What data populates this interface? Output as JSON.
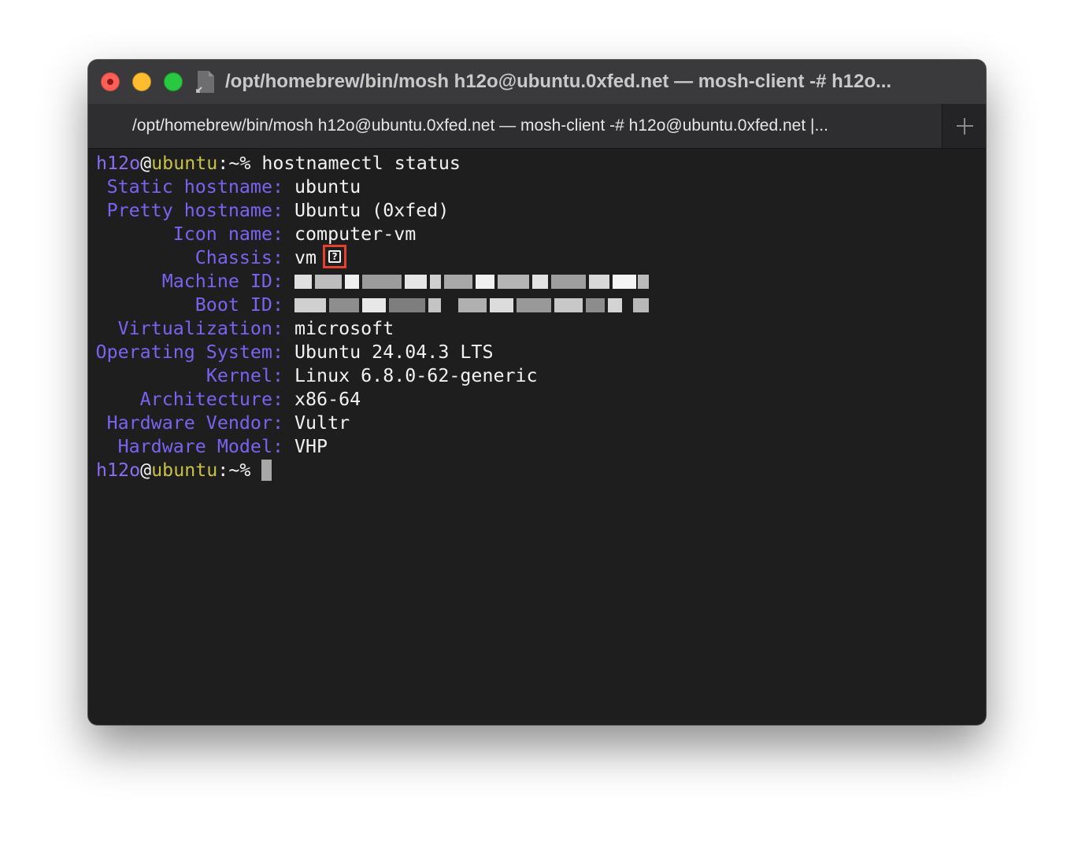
{
  "window": {
    "title": "/opt/homebrew/bin/mosh h12o@ubuntu.0xfed.net — mosh-client -# h12o...",
    "tab_title": "/opt/homebrew/bin/mosh h12o@ubuntu.0xfed.net — mosh-client -# h12o@ubuntu.0xfed.net |...",
    "traffic_lights": [
      "close",
      "minimize",
      "maximize"
    ],
    "new_tab_icon": "plus-icon",
    "proxy_icon": "document-icon"
  },
  "prompt": {
    "user": "h12o",
    "at": "@",
    "host": "ubuntu",
    "suffix": ":~%",
    "command": "hostnamectl status"
  },
  "output": [
    {
      "label": "Static hostname:",
      "value": "ubuntu"
    },
    {
      "label": "Pretty hostname:",
      "value": "Ubuntu (0xfed)"
    },
    {
      "label": "Icon name:",
      "value": "computer-vm"
    },
    {
      "label": "Chassis:",
      "value": "vm",
      "glyph": "?"
    },
    {
      "label": "Machine ID:",
      "value": "",
      "redacted": true
    },
    {
      "label": "Boot ID:",
      "value": "",
      "redacted": true
    },
    {
      "label": "Virtualization:",
      "value": "microsoft"
    },
    {
      "label": "Operating System:",
      "value": "Ubuntu 24.04.3 LTS"
    },
    {
      "label": "Kernel:",
      "value": "Linux 6.8.0-62-generic"
    },
    {
      "label": "Architecture:",
      "value": "x86-64"
    },
    {
      "label": "Hardware Vendor:",
      "value": "Vultr"
    },
    {
      "label": "Hardware Model:",
      "value": "VHP"
    }
  ],
  "colors": {
    "user": "#8a6cf5",
    "host": "#c9c146",
    "label": "#7a63f1",
    "text": "#f2f2f2",
    "background": "#1e1e1e",
    "highlight_box": "#e8412b"
  }
}
